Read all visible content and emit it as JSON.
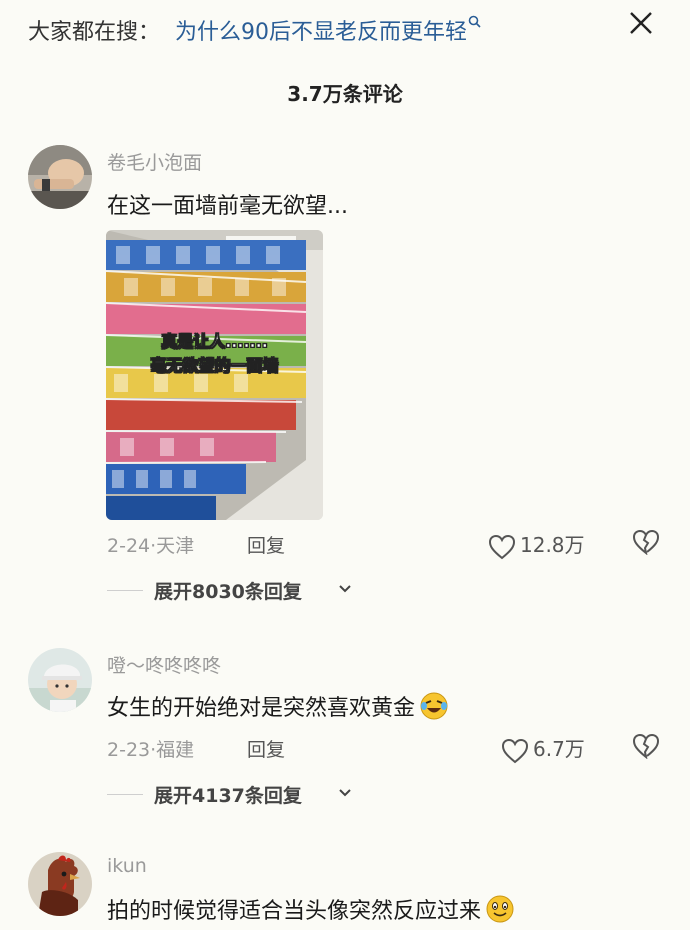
{
  "search": {
    "prefix": "大家都在搜：",
    "query": "为什么90后不显老反而更年轻"
  },
  "comments_header": {
    "title": "3.7万条评论"
  },
  "comments": [
    {
      "username": "卷毛小泡面",
      "text": "在这一面墙前毫无欲望...",
      "image_caption_line1": "真是让人.......",
      "image_caption_line2": "毫无欲望的一面墙",
      "date": "2-24",
      "location": "天津",
      "reply_label": "回复",
      "likes": "12.8万",
      "expand_label": "展开8030条回复"
    },
    {
      "username": "噔～咚咚咚咚",
      "text": "女生的开始绝对是突然喜欢黄金",
      "date": "2-23",
      "location": "福建",
      "reply_label": "回复",
      "likes": "6.7万",
      "expand_label": "展开4137条回复"
    },
    {
      "username": "ikun",
      "text": "拍的时候觉得适合当头像突然反应过来"
    }
  ],
  "colors": {
    "background": "#fbfbf6",
    "link": "#2a5d96",
    "muted": "#999999"
  }
}
